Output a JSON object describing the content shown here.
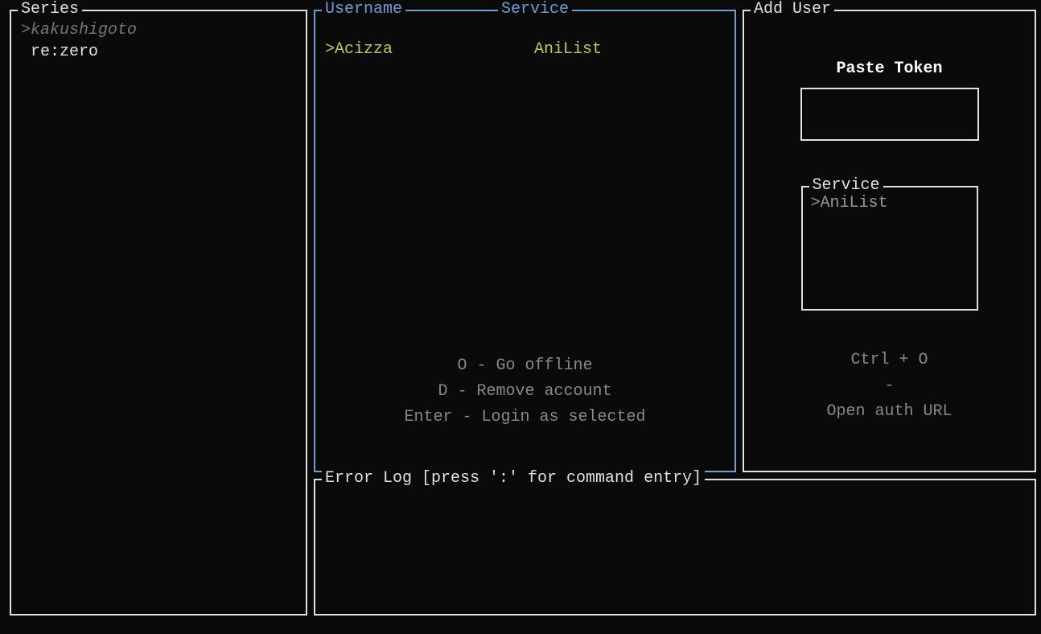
{
  "series": {
    "title": "Series",
    "items": [
      {
        "label": "kakushigoto",
        "selected": true
      },
      {
        "label": "re:zero",
        "selected": false
      }
    ]
  },
  "users": {
    "title_username": "Username",
    "title_service": "Service",
    "rows": [
      {
        "username": "Acizza",
        "service": "AniList",
        "selected": true
      }
    ],
    "hints": {
      "line1": "O - Go offline",
      "line2": "D - Remove account",
      "line3": "Enter - Login as selected"
    }
  },
  "adduser": {
    "title": "Add User",
    "token_label": "Paste Token",
    "token_value": "",
    "service_title": "Service",
    "service_options": [
      {
        "label": "AniList",
        "selected": true
      }
    ],
    "hints": {
      "line1": "Ctrl + O",
      "line2": "-",
      "line3": "Open auth URL"
    }
  },
  "errorlog": {
    "title": "Error Log [press ':' for command entry]"
  }
}
